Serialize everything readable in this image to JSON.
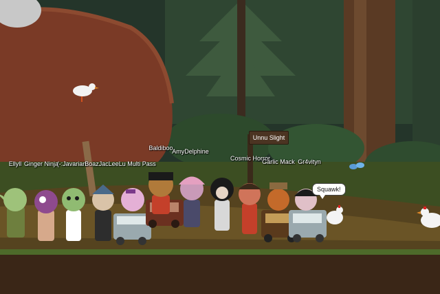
{
  "scene": {
    "sign_text": "Unnu Slight",
    "speech_bubble": "Squawk!",
    "player_names": [
      "Ellyll",
      "Ginger Ninja",
      "(-:Javarian",
      "BoazJacLeeLu Multi Pass",
      "Baldiboo",
      "AmyDelphine",
      "Cosmic Horror",
      "Garlic Mack",
      "Gr4vityn"
    ]
  }
}
